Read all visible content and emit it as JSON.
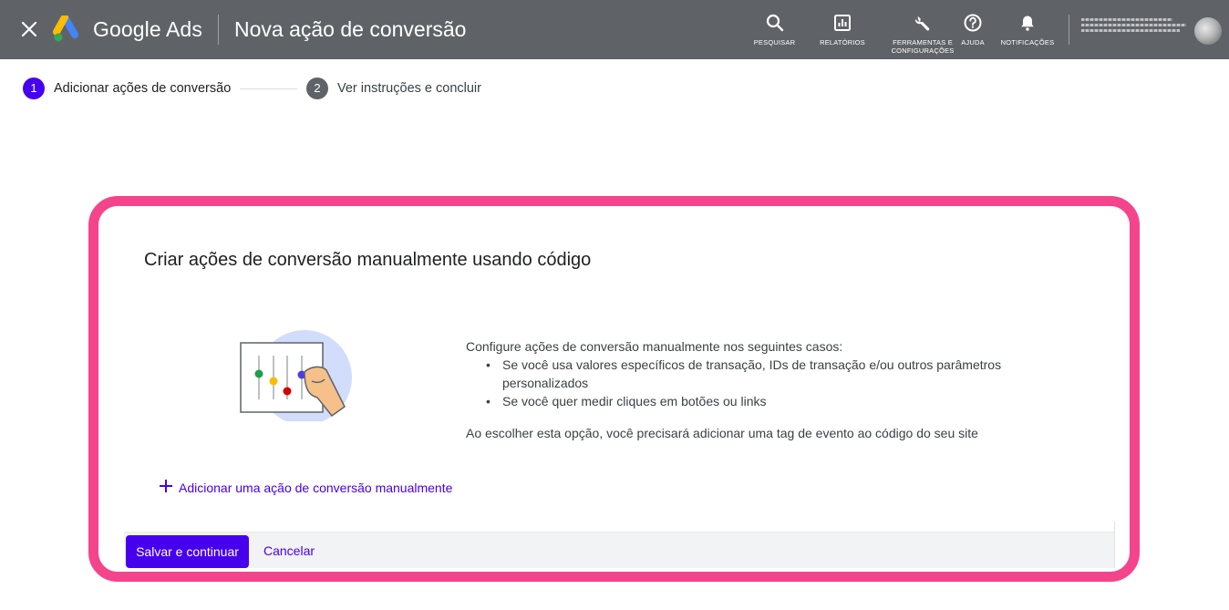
{
  "header": {
    "brand": "Google Ads",
    "page_title": "Nova ação de conversão",
    "tools": {
      "search": "PESQUISAR",
      "reports": "RELATÓRIOS",
      "tools_line1": "FERRAMENTAS E",
      "tools_line2": "CONFIGURAÇÕES",
      "help": "AJUDA",
      "notifications": "NOTIFICAÇÕES"
    },
    "icons": [
      "close-icon",
      "google-ads-logo",
      "search-icon",
      "reports-icon",
      "wrench-icon",
      "help-icon",
      "bell-icon"
    ]
  },
  "stepper": {
    "steps": [
      {
        "number": "1",
        "label": "Adicionar ações de conversão",
        "state": "active"
      },
      {
        "number": "2",
        "label": "Ver instruções e concluir",
        "state": "inactive"
      }
    ]
  },
  "card": {
    "title": "Criar ações de conversão manualmente usando código",
    "intro": "Configure ações de conversão manualmente nos seguintes casos:",
    "bullets": [
      "Se você usa valores específicos de transação, IDs de transação e/ou outros parâmetros personalizados",
      "Se você quer medir cliques em botões ou links"
    ],
    "note": "Ao escolher esta opção, você precisará adicionar uma tag de evento ao código do seu site",
    "add_link": "Adicionar uma ação de conversão manualmente"
  },
  "footer": {
    "save": "Salvar e continuar",
    "cancel": "Cancelar"
  },
  "colors": {
    "topbar": "#5f6368",
    "accent": "#4700ee",
    "highlight": "#f4448c"
  }
}
